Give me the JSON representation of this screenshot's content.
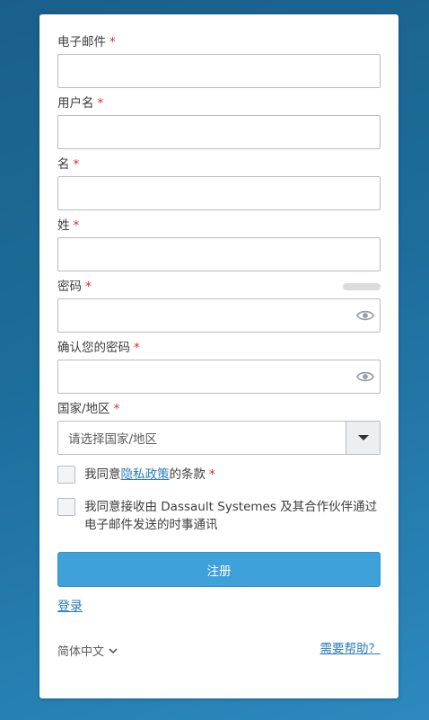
{
  "form": {
    "email": {
      "label": "电子邮件",
      "required": "*",
      "value": ""
    },
    "username": {
      "label": "用户名",
      "required": "*",
      "value": ""
    },
    "first_name": {
      "label": "名",
      "required": "*",
      "value": ""
    },
    "last_name": {
      "label": "姓",
      "required": "*",
      "value": ""
    },
    "password": {
      "label": "密码",
      "required": "*",
      "value": "",
      "icon": "eye-icon"
    },
    "confirm_password": {
      "label": "确认您的密码",
      "required": "*",
      "value": "",
      "icon": "eye-icon"
    },
    "country": {
      "label": "国家/地区",
      "required": "*",
      "placeholder": "请选择国家/地区"
    },
    "privacy": {
      "prefix": "我同意",
      "link": "隐私政策",
      "suffix": "的条款",
      "required": "*"
    },
    "newsletter": {
      "text": "我同意接收由 Dassault Systemes 及其合作伙伴通过电子邮件发送的时事通讯"
    },
    "submit_label": "注册"
  },
  "footer": {
    "login_label": "登录",
    "language": "简体中文",
    "help_label": "需要帮助？"
  },
  "colors": {
    "accent": "#3ea1d9",
    "link": "#2a7bbd",
    "required": "#d12c2c"
  }
}
